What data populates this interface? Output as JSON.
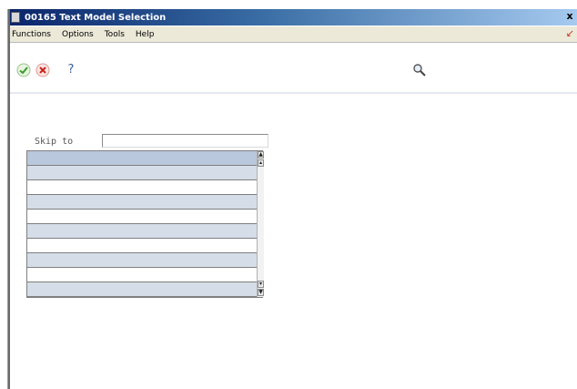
{
  "window": {
    "title": "00165 Text Model Selection",
    "close_glyph": "x"
  },
  "menubar": {
    "items": [
      {
        "label": "Functions"
      },
      {
        "label": "Options"
      },
      {
        "label": "Tools"
      },
      {
        "label": "Help"
      }
    ]
  },
  "toolbar": {
    "buttons": [
      {
        "name": "ok",
        "icon": "checkmark-icon",
        "color": "#3a9a2a"
      },
      {
        "name": "cancel",
        "icon": "x-circle-icon",
        "color": "#c8231e"
      },
      {
        "name": "help",
        "icon": "question-icon",
        "glyph": "?"
      },
      {
        "name": "find",
        "icon": "magnifier-icon"
      }
    ]
  },
  "form": {
    "skip_to": {
      "label": "Skip to",
      "value": ""
    }
  },
  "grid": {
    "rows": [
      "",
      "",
      "",
      "",
      "",
      "",
      "",
      "",
      "",
      ""
    ]
  },
  "colors": {
    "title_start": "#0a246a",
    "row_band": "#d5dde8",
    "row_selected": "#b9c8dc"
  }
}
